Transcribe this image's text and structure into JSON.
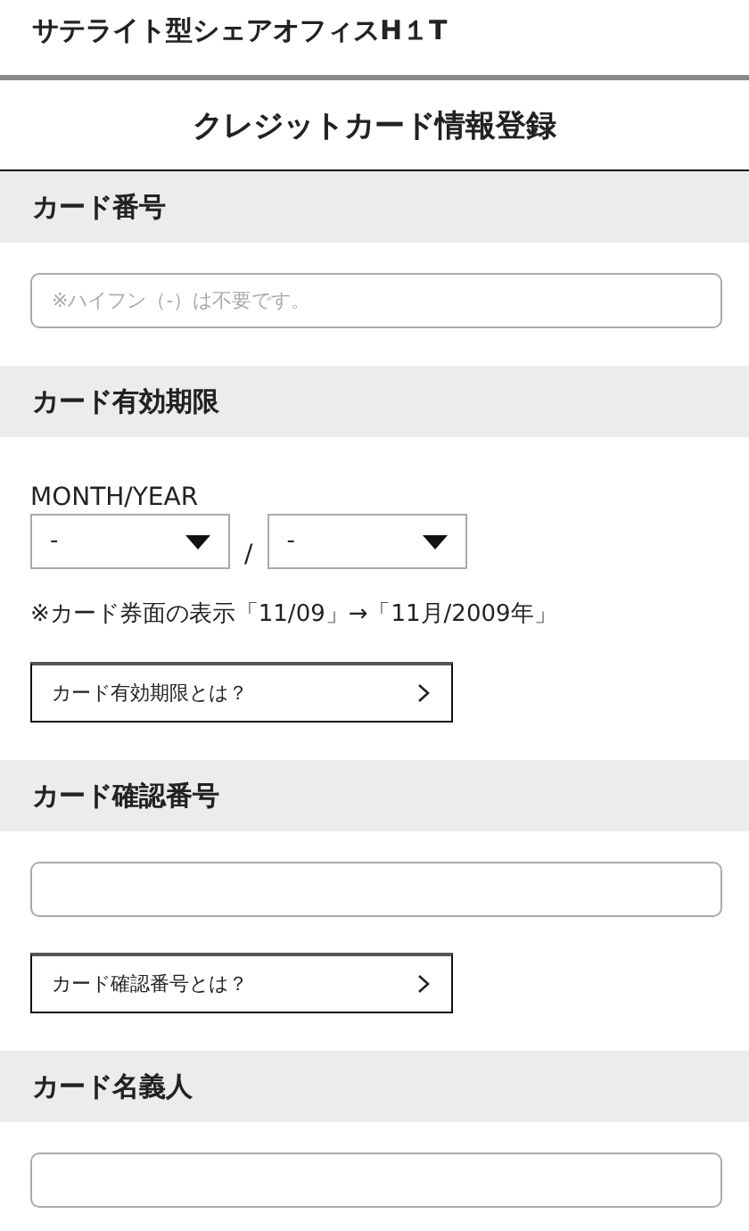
{
  "site_title": "サテライト型シェアオフィスH１T",
  "page_title": "クレジットカード情報登録",
  "sections": [
    {
      "heading": "カード番号",
      "fields": [
        {
          "kind": "input",
          "placeholder": "※ハイフン（-）は不要です。"
        }
      ]
    },
    {
      "heading": "カード有効期限",
      "fields": [
        {
          "kind": "label",
          "text": "MONTH/YEAR"
        },
        {
          "kind": "selects",
          "month": "-",
          "separator": "/",
          "year": "-"
        },
        {
          "kind": "note",
          "text": "※カード券面の表示「11/09」→「11月/2009年」"
        },
        {
          "kind": "link_button",
          "label": "カード有効期限とは？"
        }
      ]
    },
    {
      "heading": "カード確認番号",
      "fields": [
        {
          "kind": "input"
        },
        {
          "kind": "link_button",
          "label": "カード確認番号とは？"
        }
      ]
    },
    {
      "heading": "カード名義人",
      "fields": [
        {
          "kind": "input"
        }
      ]
    }
  ]
}
